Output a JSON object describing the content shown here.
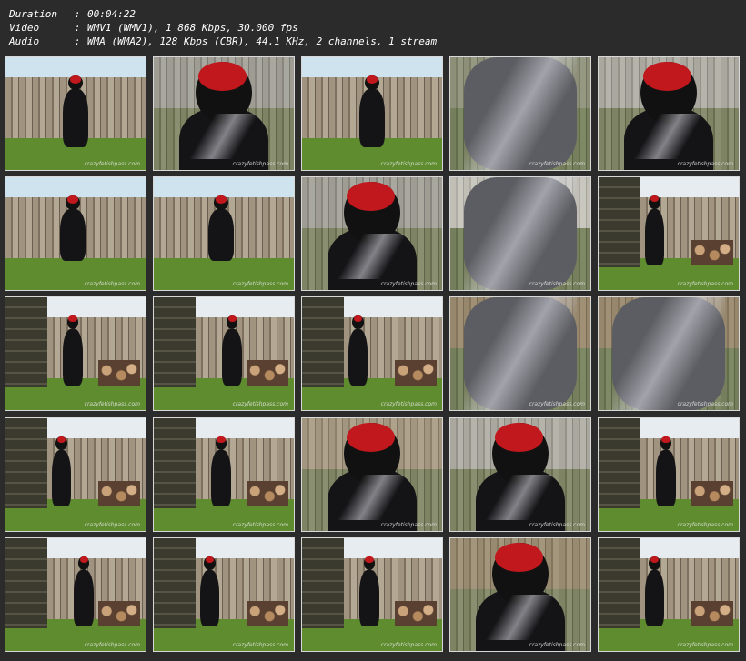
{
  "info": {
    "duration_label": "Duration",
    "duration_value": "00:04:22",
    "video_label": "Video",
    "video_value": "WMV1 (WMV1), 1 868 Kbps, 30.000 fps",
    "audio_label": "Audio",
    "audio_value": "WMA (WMA2), 128 Kbps (CBR), 44.1 KHz, 2 channels, 1 stream",
    "separator": ":"
  },
  "watermark": "crazyfetishpass.com",
  "thumbnails": [
    {
      "scene": "fence-wide",
      "sky": "#cfe3ef"
    },
    {
      "scene": "closeup-mask",
      "sky": "#9aa7b0"
    },
    {
      "scene": "fence-wide",
      "sky": "#cfe3ef"
    },
    {
      "scene": "closeup-silver",
      "sky": "#7a8a70"
    },
    {
      "scene": "closeup-mask",
      "sky": "#b9c6cc"
    },
    {
      "scene": "fence-squat",
      "sky": "#cfe3ef"
    },
    {
      "scene": "fence-squat",
      "sky": "#cfe3ef"
    },
    {
      "scene": "closeup-mask",
      "sky": "#9aa7b0"
    },
    {
      "scene": "closeup-silver",
      "sky": "#dfe7ea"
    },
    {
      "scene": "shed-logs",
      "sky": "#e6ecef"
    },
    {
      "scene": "shed-logs",
      "sky": "#e6ecef"
    },
    {
      "scene": "shed-logs",
      "sky": "#e6ecef"
    },
    {
      "scene": "shed-logs",
      "sky": "#e6ecef"
    },
    {
      "scene": "closeup-silver",
      "sky": "#8c7a5a"
    },
    {
      "scene": "closeup-silver",
      "sky": "#8c7a5a"
    },
    {
      "scene": "shed-logs",
      "sky": "#e6ecef"
    },
    {
      "scene": "shed-logs",
      "sky": "#e6ecef"
    },
    {
      "scene": "closeup-mask",
      "sky": "#a89a80"
    },
    {
      "scene": "closeup-mask",
      "sky": "#b9c6cc"
    },
    {
      "scene": "shed-logs",
      "sky": "#e6ecef"
    },
    {
      "scene": "shed-logs",
      "sky": "#e6ecef"
    },
    {
      "scene": "shed-logs",
      "sky": "#e6ecef"
    },
    {
      "scene": "shed-logs",
      "sky": "#e6ecef"
    },
    {
      "scene": "closeup-mask",
      "sky": "#8c7a5a"
    },
    {
      "scene": "shed-logs",
      "sky": "#e6ecef"
    }
  ]
}
